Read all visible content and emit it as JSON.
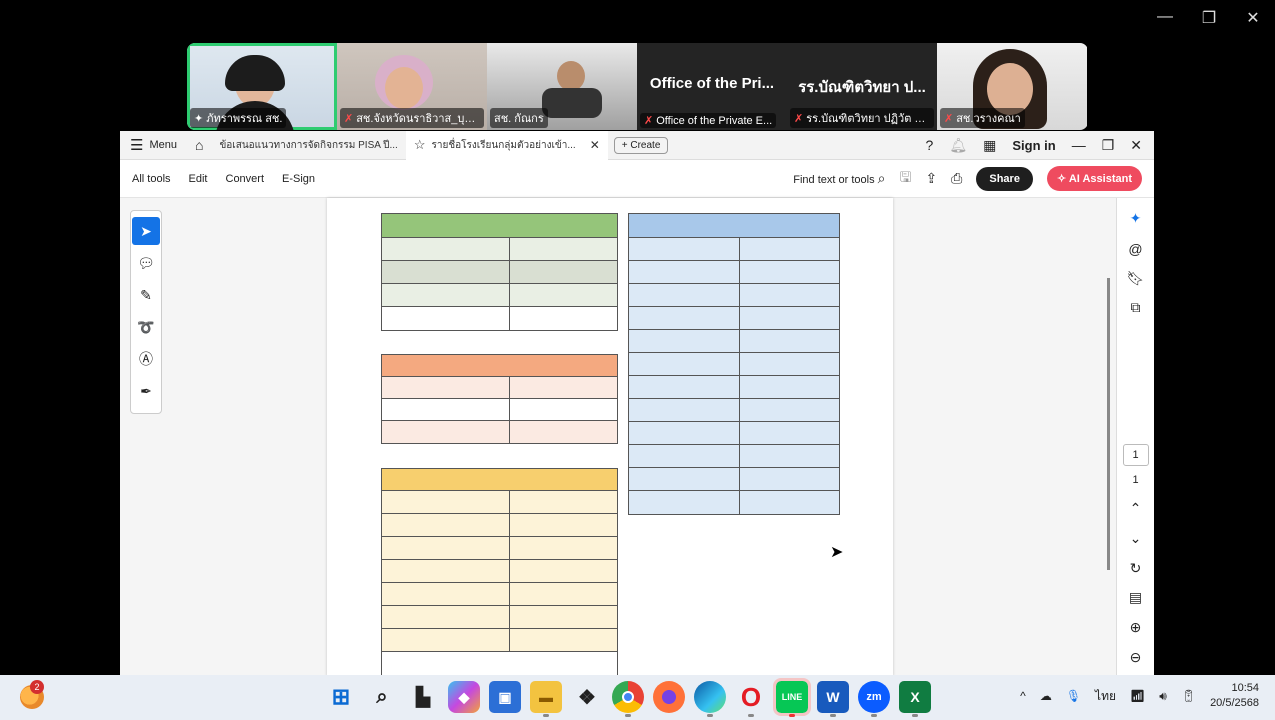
{
  "zoom_window": {
    "minimize": "—",
    "restore": "❐",
    "close": "✕"
  },
  "participants": [
    {
      "name": "ภัทราพรรณ สช.",
      "active": true,
      "muted": false,
      "pinned": true
    },
    {
      "name": "สช.จังหวัดนราธิวาส_บุริย...",
      "muted": true
    },
    {
      "name": "สช. กัณกร",
      "muted": false
    },
    {
      "label": "Office of the Pri...",
      "name": "Office of the Private E...",
      "muted": true
    },
    {
      "label": "รร.บัณฑิตวิทยา ป...",
      "name": "รร.บัณฑิตวิทยา ปฏิวัต ค...",
      "muted": true
    },
    {
      "name": "สช.วรางคณา",
      "muted": true
    }
  ],
  "acrobat": {
    "menu_label": "Menu",
    "tabs": [
      {
        "label": "ข้อเสนอแนวทางการจัดกิจกรรม PISA ปี..."
      },
      {
        "label": "รายชื่อโรงเรียนกลุ่มตัวอย่างเข้า..."
      }
    ],
    "create_label": "Create",
    "signin": "Sign in",
    "toolbar": {
      "items": [
        "All tools",
        "Edit",
        "Convert",
        "E-Sign"
      ],
      "find": "Find text or tools",
      "share": "Share",
      "ai": "AI Assistant"
    },
    "page_current": "1",
    "page_total": "1"
  },
  "taskbar": {
    "notifications": "2",
    "lang": "ไทย",
    "time": "10:54",
    "date": "20/5/2568"
  }
}
